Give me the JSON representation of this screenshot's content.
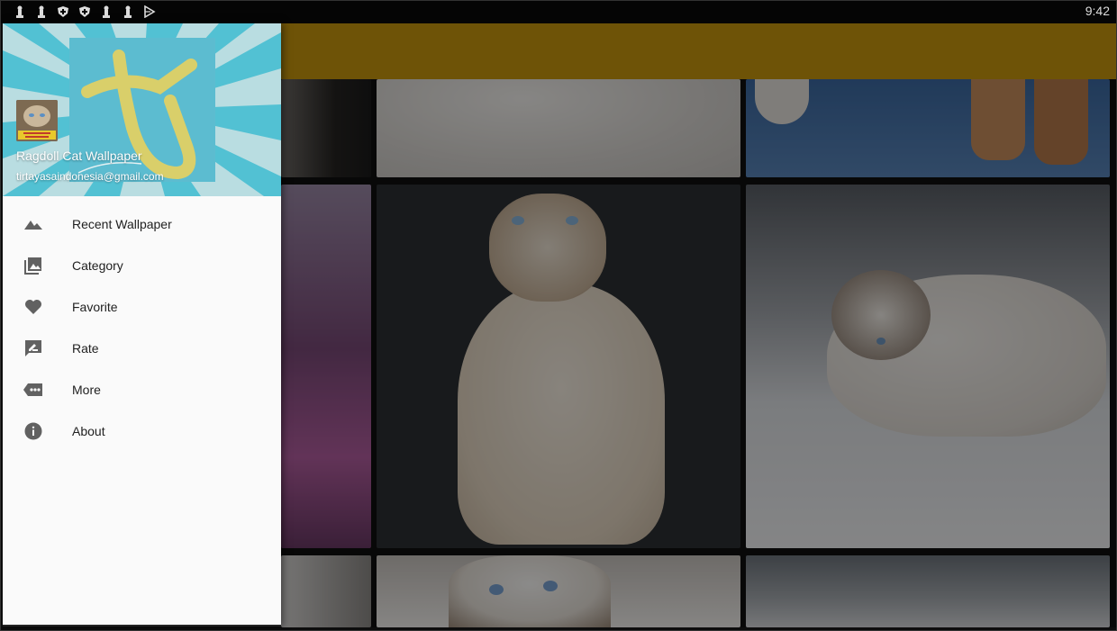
{
  "status_bar": {
    "time": "9:42",
    "notification_icons": [
      "chess-pawn-icon",
      "chess-pawn-icon",
      "shield-icon",
      "shield-icon",
      "chess-pawn-icon",
      "chess-pawn-icon",
      "play-store-icon"
    ]
  },
  "drawer": {
    "header": {
      "app_name": "Ragdoll Cat Wallpaper",
      "email": "tirtayasaindonesia@gmail.com",
      "logo_signature": "tirtayasa"
    },
    "items": [
      {
        "label": "Recent Wallpaper",
        "icon": "landscape-icon"
      },
      {
        "label": "Category",
        "icon": "photo-library-icon"
      },
      {
        "label": "Favorite",
        "icon": "heart-icon"
      },
      {
        "label": "Rate",
        "icon": "rate-review-icon"
      },
      {
        "label": "More",
        "icon": "more-icon"
      },
      {
        "label": "About",
        "icon": "info-icon"
      }
    ]
  },
  "colors": {
    "app_bar": "#6e5307",
    "drawer_background": "#fafafa",
    "header_accent": "#5cbcd0",
    "icon_color": "#616161"
  }
}
